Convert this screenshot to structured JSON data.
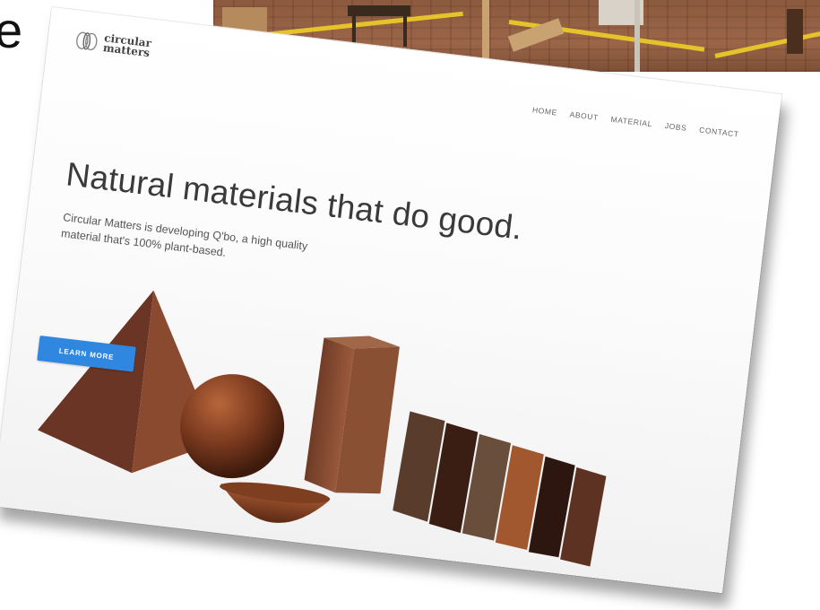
{
  "slide": {
    "partial_text": "e"
  },
  "site": {
    "logo": {
      "line1": "circular",
      "line2": "matters"
    },
    "nav": [
      "HOME",
      "ABOUT",
      "MATERIAL",
      "JOBS",
      "CONTACT"
    ],
    "hero": {
      "headline": "Natural materials that do good.",
      "subheadline": "Circular Matters is developing Q'bo, a high quality material that's 100% plant-based.",
      "cta": "LEARN MORE"
    }
  },
  "colors": {
    "cta_button": "#2f87e0",
    "material_brown": "#7a3e24",
    "workshop_floor": "#8c5a3e",
    "floor_marking": "#e5c42b"
  }
}
